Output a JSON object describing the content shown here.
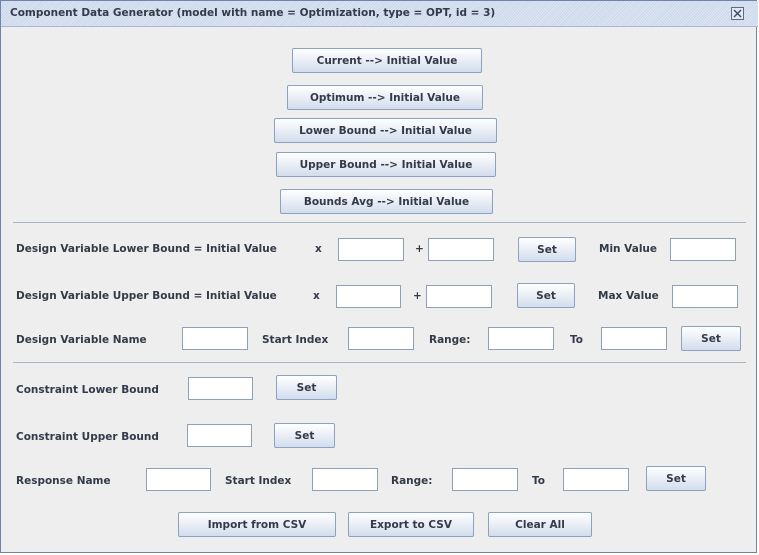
{
  "window": {
    "title": "Component Data Generator (model with name = Optimization, type = OPT, id = 3)"
  },
  "initial_value_buttons": [
    "Current --> Initial Value",
    "Optimum --> Initial Value",
    "Lower Bound --> Initial Value",
    "Upper Bound --> Initial Value",
    "Bounds Avg --> Initial Value"
  ],
  "design_variables": {
    "lower_bound_row": {
      "label": "Design Variable Lower Bound = Initial Value",
      "multiply": "x",
      "plus": "+",
      "factor_value": "",
      "offset_value": "",
      "set_label": "Set",
      "limit_label": "Min Value",
      "limit_value": ""
    },
    "upper_bound_row": {
      "label": "Design Variable Upper Bound = Initial Value",
      "multiply": "x",
      "plus": "+",
      "factor_value": "",
      "offset_value": "",
      "set_label": "Set",
      "limit_label": "Max Value",
      "limit_value": ""
    },
    "name_row": {
      "name_label": "Design Variable Name",
      "name_value": "",
      "start_index_label": "Start Index",
      "start_index_value": "",
      "range_label": "Range:",
      "range_value": "",
      "to_label": "To",
      "to_value": "",
      "set_label": "Set"
    }
  },
  "constraints": {
    "lower_label": "Constraint Lower Bound",
    "lower_value": "",
    "lower_set_label": "Set",
    "upper_label": "Constraint Upper Bound",
    "upper_value": "",
    "upper_set_label": "Set"
  },
  "responses": {
    "name_label": "Response Name",
    "name_value": "",
    "start_index_label": "Start Index",
    "start_index_value": "",
    "range_label": "Range:",
    "range_value": "",
    "to_label": "To",
    "to_value": "",
    "set_label": "Set"
  },
  "footer_buttons": {
    "import_label": "Import from CSV",
    "export_label": "Export to CSV",
    "clear_label": "Clear All"
  },
  "colors": {
    "title_bar": "#cad7ea",
    "window_border": "#6f84a8",
    "panel_background": "#eeeeee",
    "button_border": "#8da1c1",
    "text": "#333a48"
  }
}
